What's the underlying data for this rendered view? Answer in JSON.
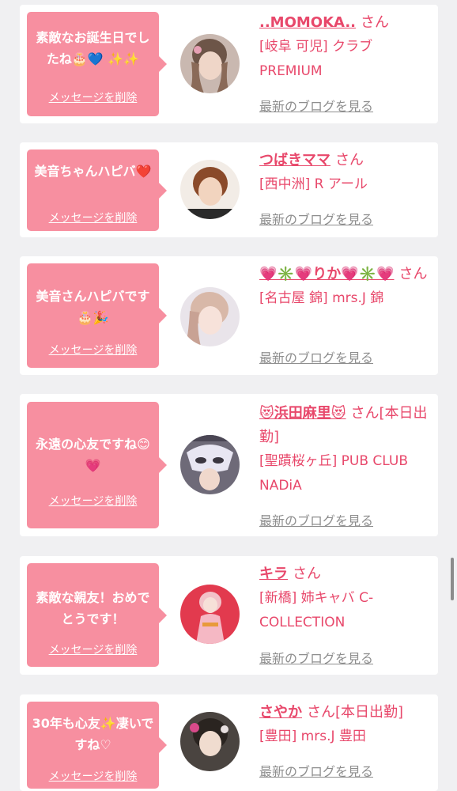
{
  "delete_label": "メッセージを削除",
  "blog_label": "最新のブログを見る",
  "san_label": "さん",
  "cards": [
    {
      "message": "素敵なお誕生日でしたね🎂💙 ✨✨",
      "name": "..MOMOKA..",
      "san_suffix": "",
      "shop": "[岐阜 可児] クラブ PREMIUM"
    },
    {
      "message": "美音ちゃんハピバ❤️",
      "name": "つばきママ",
      "san_suffix": "",
      "shop": "[西中洲] R アール"
    },
    {
      "message": "美音さんハピバです🎂🎉",
      "name": "💗✳️💗りか💗✳️💗",
      "san_suffix": "",
      "shop": "[名古屋 錦] mrs.J 錦"
    },
    {
      "message": "永遠の心友ですね😊💗",
      "name": "😻浜田麻里😻",
      "san_suffix": "[本日出勤]",
      "shop": "[聖蹟桜ヶ丘] PUB CLUB NADiA"
    },
    {
      "message": "素敵な親友！おめでとうです！",
      "name": "キラ",
      "san_suffix": "",
      "shop": "[新橋] 姉キャバ C-COLLECTION"
    },
    {
      "message": "30年も心友✨凄いですね♡",
      "name": "さやか",
      "san_suffix": "[本日出勤]",
      "shop": "[豊田] mrs.J 豊田"
    }
  ]
}
